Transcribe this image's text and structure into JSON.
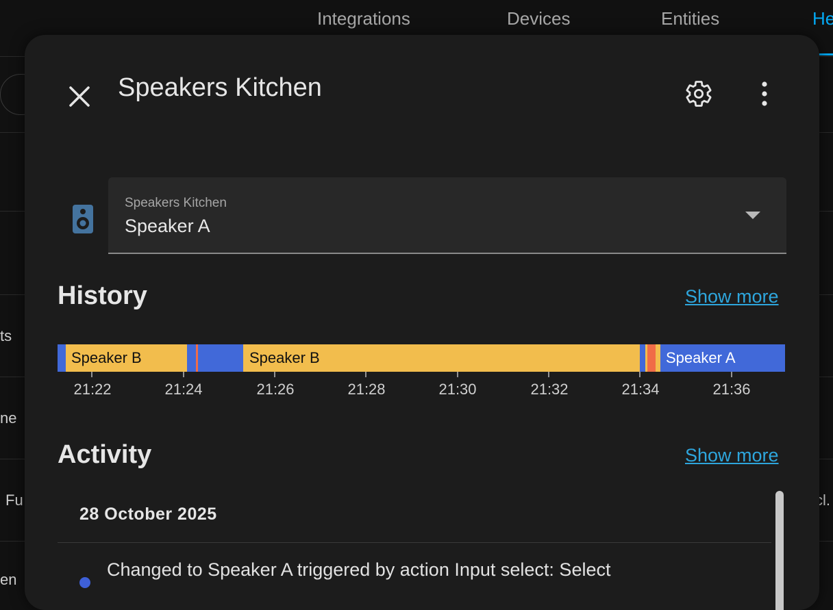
{
  "background": {
    "tabs": [
      {
        "label": "Integrations"
      },
      {
        "label": "Devices"
      },
      {
        "label": "Entities"
      },
      {
        "label": "He"
      }
    ],
    "left_texts": [
      "ts",
      "ne",
      "Fu",
      "en"
    ],
    "right_texts": [
      "cl."
    ]
  },
  "dialog": {
    "title": "Speakers Kitchen",
    "icons": {
      "close": "close-icon",
      "settings": "gear-icon",
      "more": "dots-vertical-icon",
      "entity": "speaker-icon"
    }
  },
  "select": {
    "label": "Speakers Kitchen",
    "value": "Speaker A"
  },
  "history": {
    "title": "History",
    "show_more": "Show more",
    "time_labels": [
      "21:22",
      "21:24",
      "21:26",
      "21:28",
      "21:30",
      "21:32",
      "21:34",
      "21:36"
    ],
    "segment_labels": {
      "seg1": "Speaker B",
      "seg2": "Speaker B",
      "seg3": "Speaker A"
    },
    "colors": {
      "speaker_a": "#4169d9",
      "speaker_b": "#f2bd4d",
      "other": "#f06c47"
    }
  },
  "activity": {
    "title": "Activity",
    "show_more": "Show more",
    "date": "28 October 2025",
    "entries": [
      {
        "text": "Changed to Speaker A triggered by action Input select: Select"
      }
    ]
  }
}
